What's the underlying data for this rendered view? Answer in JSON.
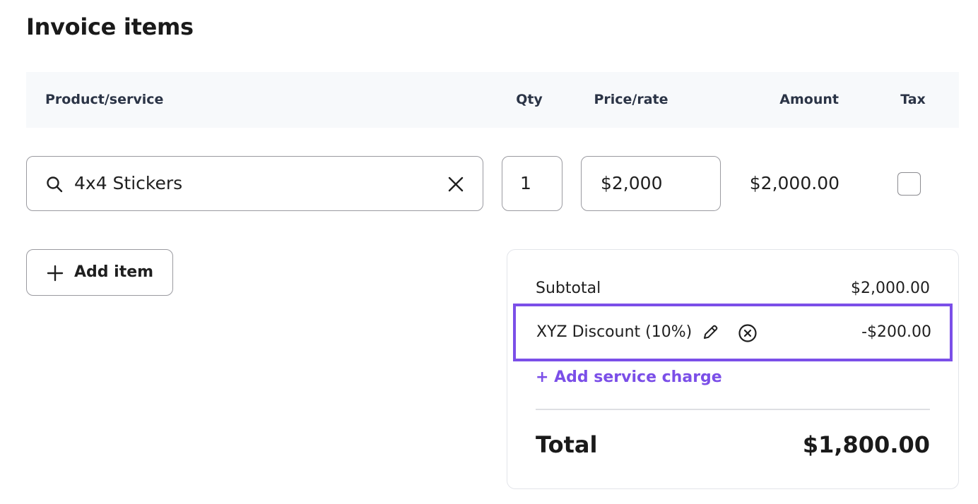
{
  "page": {
    "title": "Invoice items"
  },
  "table": {
    "headers": {
      "product": "Product/service",
      "qty": "Qty",
      "price": "Price/rate",
      "amount": "Amount",
      "tax": "Tax"
    },
    "rows": [
      {
        "product": "4x4 Stickers",
        "qty": "1",
        "price": "$2,000",
        "amount": "$2,000.00",
        "tax_checked": false
      }
    ]
  },
  "actions": {
    "add_item_label": "Add item"
  },
  "summary": {
    "subtotal_label": "Subtotal",
    "subtotal_value": "$2,000.00",
    "discount_label": "XYZ Discount (10%)",
    "discount_value": "-$200.00",
    "add_service_charge_label": "+ Add service charge",
    "total_label": "Total",
    "total_value": "$1,800.00"
  },
  "icons": {
    "search": "search-icon",
    "clear": "close-icon",
    "plus": "plus-icon",
    "edit": "pencil-icon",
    "remove": "circle-x-icon"
  },
  "colors": {
    "accent": "#7b4fe8",
    "header_bg": "#f7f9fb",
    "border": "#9a9aa0",
    "text": "#1a1a1a"
  }
}
